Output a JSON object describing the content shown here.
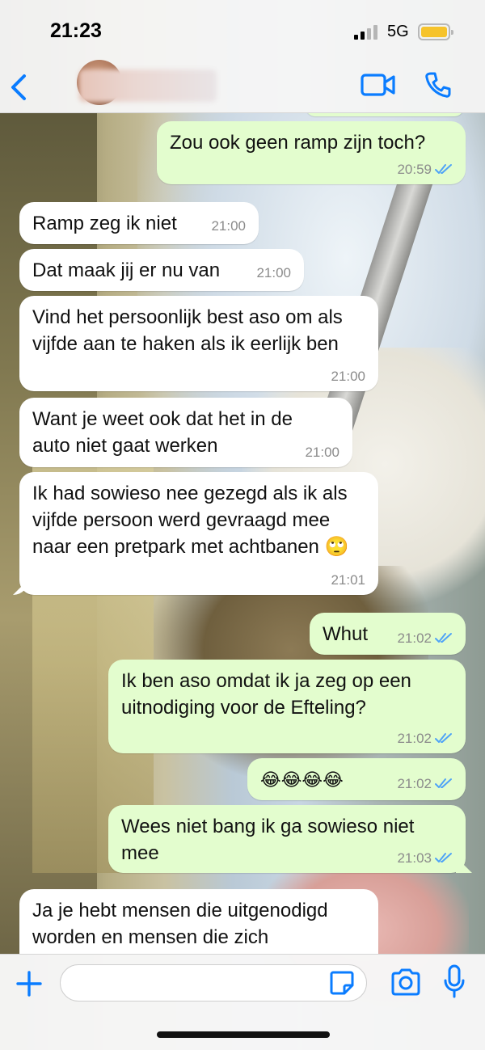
{
  "status_bar": {
    "time": "21:23",
    "network": "5G"
  },
  "header": {
    "back_icon": "chevron-left-icon",
    "video_icon": "video-camera-icon",
    "call_icon": "phone-icon"
  },
  "colors": {
    "accent": "#0a7cff",
    "outgoing_bubble": "#e3fdce",
    "incoming_bubble": "#ffffff",
    "read_ticks": "#4fa3f7",
    "battery": "#f6c32b"
  },
  "messages": [
    {
      "direction": "out",
      "text": "Zou ook geen ramp zijn toch?",
      "time": "20:59",
      "read": true
    },
    {
      "direction": "in",
      "text": "Ramp zeg ik niet",
      "time": "21:00"
    },
    {
      "direction": "in",
      "text": "Dat maak jij er nu van",
      "time": "21:00"
    },
    {
      "direction": "in",
      "text": "Vind het persoonlijk best aso om als vijfde aan te haken als ik eerlijk ben",
      "time": "21:00"
    },
    {
      "direction": "in",
      "text": "Want je weet ook dat het in de auto niet gaat werken",
      "time": "21:00"
    },
    {
      "direction": "in",
      "text": "Ik had sowieso nee gezegd als ik als vijfde persoon werd gevraagd mee naar een pretpark met achtbanen 🙄",
      "time": "21:01"
    },
    {
      "direction": "out",
      "text": "Whut",
      "time": "21:02",
      "read": true
    },
    {
      "direction": "out",
      "text": "Ik ben aso omdat ik ja zeg op een uitnodiging voor de Efteling?",
      "time": "21:02",
      "read": true
    },
    {
      "direction": "out",
      "text": "😂😂😂😂",
      "time": "21:02",
      "read": true
    },
    {
      "direction": "out",
      "text": "Wees niet bang ik ga sowieso niet mee",
      "time": "21:03",
      "read": true
    },
    {
      "direction": "in",
      "text": "Ja je hebt mensen die uitgenodigd worden en mensen die zich",
      "time": ""
    }
  ],
  "composer": {
    "plus_icon": "plus-icon",
    "sticker_icon": "sticker-icon",
    "camera_icon": "camera-icon",
    "mic_icon": "microphone-icon"
  }
}
